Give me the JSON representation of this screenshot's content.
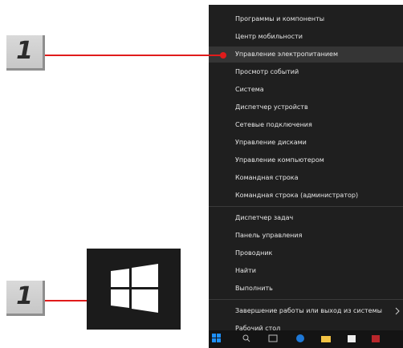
{
  "callouts": {
    "top_number": "1",
    "bottom_number": "1"
  },
  "menu": {
    "items": [
      {
        "label": "Программы и компоненты"
      },
      {
        "label": "Центр мобильности"
      },
      {
        "label": "Управление электропитанием",
        "highlighted": true
      },
      {
        "label": "Просмотр событий"
      },
      {
        "label": "Система"
      },
      {
        "label": "Диспетчер устройств"
      },
      {
        "label": "Сетевые подключения"
      },
      {
        "label": "Управление дисками"
      },
      {
        "label": "Управление компьютером"
      },
      {
        "label": "Командная строка"
      },
      {
        "label": "Командная строка (администратор)"
      },
      {
        "label": "Диспетчер задач"
      },
      {
        "label": "Панель управления"
      },
      {
        "label": "Проводник"
      },
      {
        "label": "Найти"
      },
      {
        "label": "Выполнить"
      },
      {
        "label": "Завершение работы или выход из системы",
        "has_submenu": true
      },
      {
        "label": "Рабочий стол"
      }
    ],
    "submenu_icon": "chevron-right-icon"
  },
  "icons": {
    "start_button": "windows-logo-icon"
  },
  "colors": {
    "menu_bg": "#1f1f1f",
    "menu_highlight": "#353535",
    "menu_text": "#e6e6e6",
    "callout_line": "#e01b1b",
    "badge_bg": "#d0d0d0",
    "windows_tile_bg": "#1b1b1b"
  }
}
